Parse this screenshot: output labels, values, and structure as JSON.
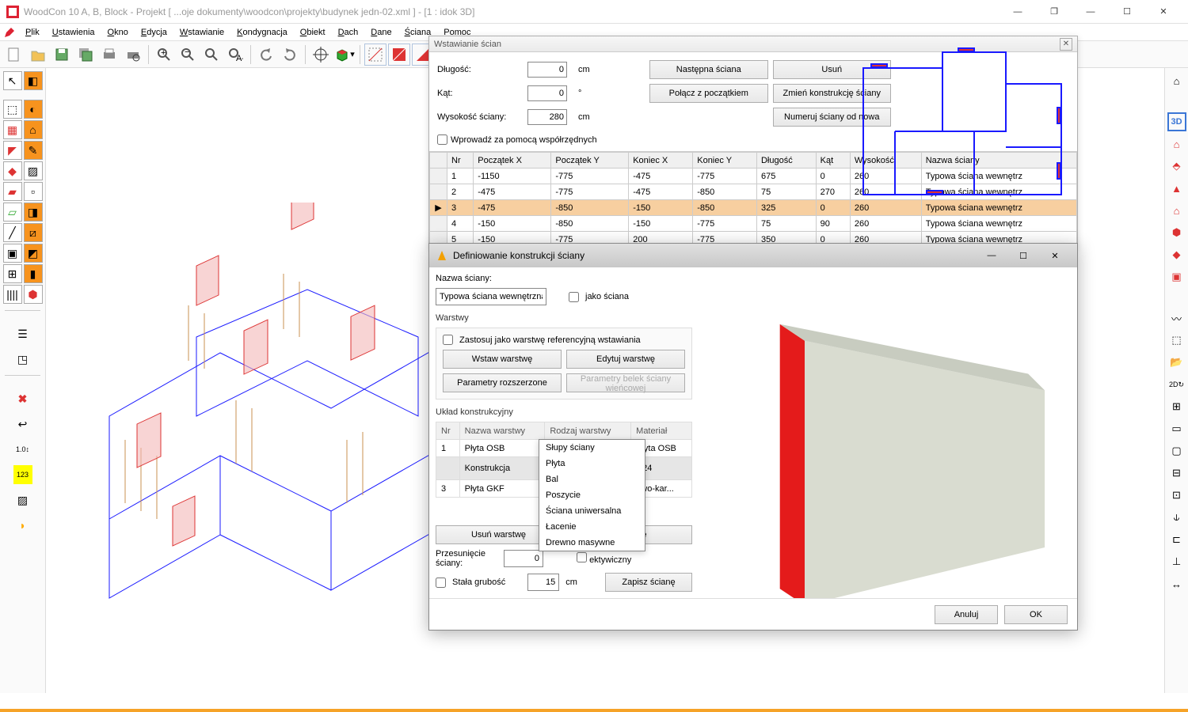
{
  "app": {
    "title": "WoodCon 10 A, B, Block - Projekt [ ...oje dokumenty\\woodcon\\projekty\\budynek jedn-02.xml ]  - [1 : idok 3D]"
  },
  "menubar": [
    "Plik",
    "Ustawienia",
    "Okno",
    "Edycja",
    "Wstawianie",
    "Kondygnacja",
    "Obiekt",
    "Dach",
    "Dane",
    "Ściana",
    "Pomoc"
  ],
  "right_toolbar_active": "3D",
  "walls_panel": {
    "title": "Wstawianie ścian",
    "length_label": "Długość:",
    "length_value": "0",
    "length_unit": "cm",
    "angle_label": "Kąt:",
    "angle_value": "0",
    "angle_unit": "°",
    "height_label": "Wysokość ściany:",
    "height_value": "280",
    "height_unit": "cm",
    "coord_check": "Wprowadź za pomocą współrzędnych",
    "btn_next": "Następna ściana",
    "btn_delete": "Usuń",
    "btn_join": "Połącz z początkiem",
    "btn_change": "Zmień konstrukcję ściany",
    "btn_renumber": "Numeruj ściany od nowa",
    "headers": [
      "",
      "Nr",
      "Początek X",
      "Początek Y",
      "Koniec X",
      "Koniec Y",
      "Długość",
      "Kąt",
      "Wysokość",
      "Nazwa ściany"
    ],
    "rows": [
      {
        "sel": false,
        "nr": "1",
        "sx": "-1150",
        "sy": "-775",
        "ex": "-475",
        "ey": "-775",
        "len": "675",
        "ang": "0",
        "h": "260",
        "name": "Typowa ściana wewnętrz"
      },
      {
        "sel": false,
        "nr": "2",
        "sx": "-475",
        "sy": "-775",
        "ex": "-475",
        "ey": "-850",
        "len": "75",
        "ang": "270",
        "h": "260",
        "name": "Typowa ściana wewnętrz"
      },
      {
        "sel": true,
        "nr": "3",
        "sx": "-475",
        "sy": "-850",
        "ex": "-150",
        "ey": "-850",
        "len": "325",
        "ang": "0",
        "h": "260",
        "name": "Typowa ściana wewnętrz"
      },
      {
        "sel": false,
        "nr": "4",
        "sx": "-150",
        "sy": "-850",
        "ex": "-150",
        "ey": "-775",
        "len": "75",
        "ang": "90",
        "h": "260",
        "name": "Typowa ściana wewnętrz"
      },
      {
        "sel": false,
        "nr": "5",
        "sx": "-150",
        "sy": "-775",
        "ex": "200",
        "ey": "-775",
        "len": "350",
        "ang": "0",
        "h": "260",
        "name": "Typowa ściana wewnętrz"
      }
    ]
  },
  "dlg": {
    "title": "Definiowanie konstrukcji ściany",
    "name_label": "Nazwa ściany:",
    "name_value": "Typowa ściana wewnętrzna",
    "as_wall_check": "jako ściana",
    "layers_label": "Warstwy",
    "ref_check": "Zastosuj jako warstwę referencyjną wstawiania",
    "btn_insert_layer": "Wstaw warstwę",
    "btn_edit_layer": "Edytuj warstwę",
    "btn_ext_params": "Parametry rozszerzone",
    "btn_beam_params": "Parametry belek ściany wieńcowej",
    "construction_label": "Układ konstrukcyjny",
    "layer_headers": [
      "Nr",
      "Nazwa warstwy",
      "Rodzaj warstwy",
      "Materiał"
    ],
    "layer_rows": [
      {
        "nr": "1",
        "name": "Płyta OSB",
        "type": "Płyta",
        "mat": "Płyta OSB"
      },
      {
        "nr": "",
        "name": "Konstrukcja",
        "type": "Słupy ściany",
        "mat": "C24",
        "sel": true
      },
      {
        "nr": "3",
        "name": "Płyta GKF",
        "type": "",
        "mat": "owo-kar..."
      }
    ],
    "dropdown_options": [
      "Słupy ściany",
      "Płyta",
      "Bal",
      "Poszycie",
      "Ściana uniwersalna",
      "Łacenie",
      "Drewno masywne"
    ],
    "btn_delete_layer": "Usuń warstwę",
    "btn_constr": "nstrukcję",
    "offset_label": "Przesunięcie ściany:",
    "offset_value": "0",
    "offset_unit": "",
    "persp_check": "ektywiczny",
    "thick_check": "Stała grubość",
    "thick_value": "15",
    "thick_unit": "cm",
    "btn_save_wall": "Zapisz ścianę",
    "btn_cancel": "Anuluj",
    "btn_ok": "OK"
  }
}
